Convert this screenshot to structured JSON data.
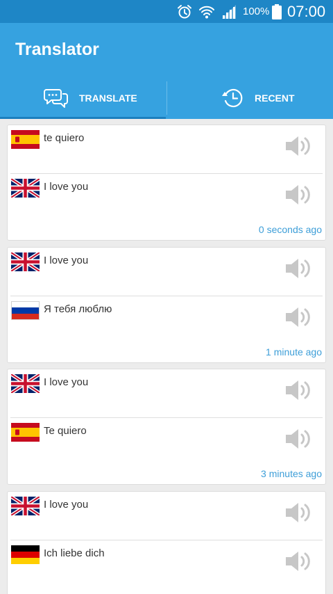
{
  "status_bar": {
    "battery_percent": "100%",
    "time": "07:00"
  },
  "app": {
    "title": "Translator"
  },
  "tabs": [
    {
      "label": "TRANSLATE",
      "active": true
    },
    {
      "label": "RECENT",
      "active": false
    }
  ],
  "history": [
    {
      "source": {
        "flag": "spain-flag-icon",
        "text": "te quiero"
      },
      "target": {
        "flag": "uk-flag-icon",
        "text": "I love you"
      },
      "time": "0 seconds ago"
    },
    {
      "source": {
        "flag": "uk-flag-icon",
        "text": "I love you"
      },
      "target": {
        "flag": "russia-flag-icon",
        "text": "Я тебя люблю"
      },
      "time": "1 minute ago"
    },
    {
      "source": {
        "flag": "uk-flag-icon",
        "text": "I love you"
      },
      "target": {
        "flag": "spain-flag-icon",
        "text": "Te quiero"
      },
      "time": "3 minutes ago"
    },
    {
      "source": {
        "flag": "uk-flag-icon",
        "text": "I love you"
      },
      "target": {
        "flag": "germany-flag-icon",
        "text": "Ich liebe dich"
      },
      "time": ""
    }
  ],
  "colors": {
    "status_bar": "#1e86c6",
    "app_bar": "#36a2e0",
    "timestamp": "#3d9ed8"
  }
}
